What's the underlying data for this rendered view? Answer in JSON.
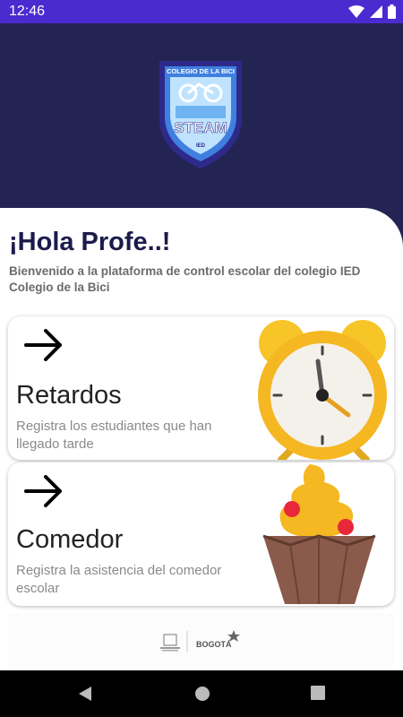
{
  "status_bar": {
    "time": "12:46",
    "icons": [
      "wifi-icon",
      "signal-icon",
      "battery-icon"
    ]
  },
  "header": {
    "logo": {
      "icon": "school-shield-logo",
      "text_top": "COLEGIO DE LA BICI",
      "text_mid": "STEAM",
      "text_bottom": "IED"
    }
  },
  "main": {
    "greeting": "¡Hola Profe..!",
    "welcome": "Bienvenido a la plataforma de control escolar del colegio IED Colegio de la Bici",
    "cards": [
      {
        "title": "Retardos",
        "description": "Registra los estudiantes que han llegado tarde",
        "icon": "arrow-right-icon",
        "image": "alarm-clock-image"
      },
      {
        "title": "Comedor",
        "description": "Registra la asistencia del comedor escolar",
        "icon": "arrow-right-icon",
        "image": "cupcake-image"
      }
    ]
  },
  "footer": {
    "logo_text": "BOGOTÁ",
    "icons": [
      "alcaldia-seal-logo",
      "bogota-logo"
    ]
  },
  "nav_bar": {
    "icons": [
      "back-icon",
      "home-icon",
      "recents-icon"
    ]
  },
  "colors": {
    "status_bar": "#4a2bd0",
    "header_bg": "#242454",
    "greeting_text": "#1b1b4b",
    "card_bg": "#ffffff"
  }
}
